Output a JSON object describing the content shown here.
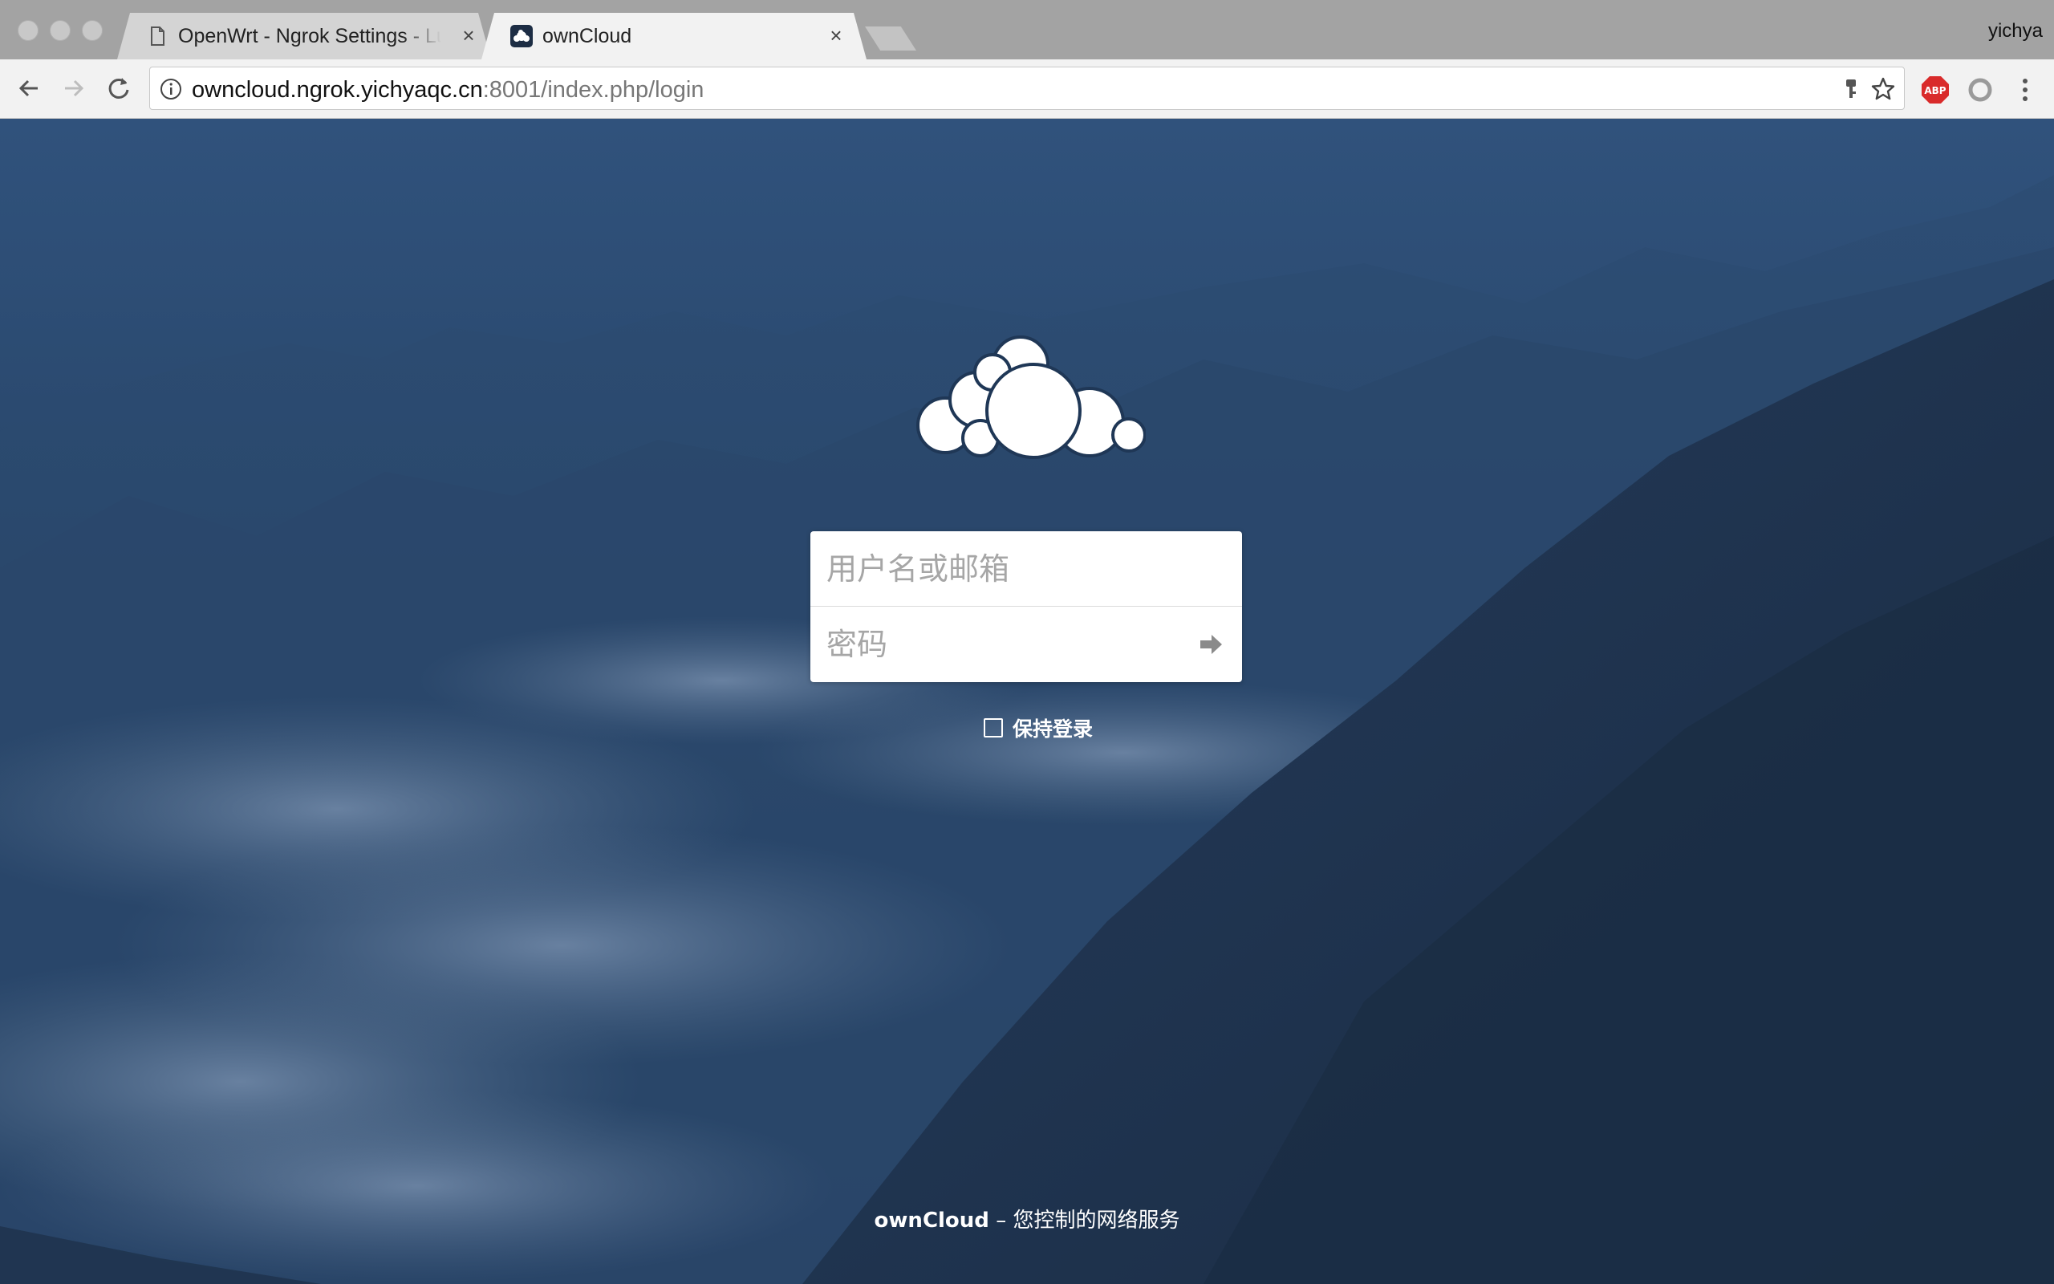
{
  "browser": {
    "tabs": [
      {
        "title": "OpenWrt - Ngrok Settings - LuCI",
        "active": false,
        "favicon": "document-icon"
      },
      {
        "title": "ownCloud",
        "active": true,
        "favicon": "owncloud-icon"
      }
    ],
    "profile_name": "yichya",
    "url_host": "owncloud.ngrok.yichyaqc.cn",
    "url_rest": ":8001/index.php/login",
    "extensions": [
      "adblock-plus-icon",
      "extension-circle-icon"
    ]
  },
  "login": {
    "username_placeholder": "用户名或邮箱",
    "password_placeholder": "密码",
    "remember_label": "保持登录"
  },
  "footer": {
    "brand": "ownCloud",
    "tagline": "– 您控制的网络服务"
  },
  "colors": {
    "background_top": "#30527c",
    "background_bottom": "#1e3350",
    "abp_red": "#d92b2b"
  }
}
